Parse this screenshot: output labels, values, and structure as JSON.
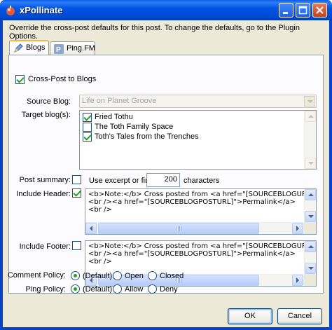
{
  "window": {
    "title": "xPollinate"
  },
  "description": "Override the cross-post defaults for this post. To change the defaults, go to the Plugin Options.",
  "tabs": [
    {
      "label": "Blogs",
      "icon": "blog-icon",
      "active": true
    },
    {
      "label": "Ping.FM",
      "icon": "pingfm-icon",
      "active": false
    }
  ],
  "crosspost": {
    "label": "Cross-Post to Blogs",
    "checked": true
  },
  "source_blog": {
    "label": "Source Blog:",
    "value": "Life on Planet Groove"
  },
  "target_blogs": {
    "label": "Target blog(s):",
    "items": [
      {
        "label": "Fried Tothu",
        "checked": true
      },
      {
        "label": "The Toth Family Space",
        "checked": false
      },
      {
        "label": "Toth's Tales from the Trenches",
        "checked": true
      }
    ]
  },
  "post_summary": {
    "label": "Post summary:",
    "checkbox_label": "Use excerpt or first",
    "value": "200",
    "suffix": "characters",
    "checked": false
  },
  "include_header": {
    "label": "Include Header:",
    "checked": true,
    "text": "<b>Note:</b> Cross posted from <a href=\"[SOURCEBLOGURL]\">[SOURC\n<br /><a href=\"[SOURCEBLOGPOSTURL]\">Permalink</a>\n<br />"
  },
  "include_footer": {
    "label": "Include Footer:",
    "checked": false,
    "text": "<b>Note:</b> Cross posted from <a href=\"[SOURCEBLOGURL]\">[SOURC\n<br /><a href=\"[SOURCEBLOGPOSTURL]\">Permalink</a>\n<br />"
  },
  "comment_policy": {
    "label": "Comment Policy:",
    "options": [
      "(Default)",
      "Open",
      "Closed"
    ],
    "selected": "(Default)"
  },
  "ping_policy": {
    "label": "Ping Policy:",
    "options": [
      "(Default)",
      "Allow",
      "Deny"
    ],
    "selected": "(Default)"
  },
  "buttons": {
    "ok": "OK",
    "cancel": "Cancel"
  }
}
